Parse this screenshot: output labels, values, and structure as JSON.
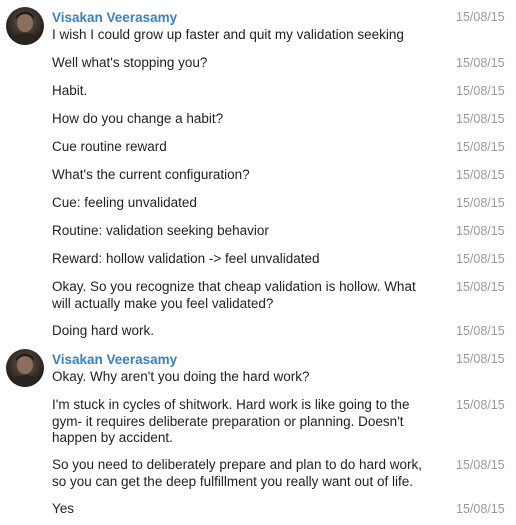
{
  "messages": [
    {
      "sender": "Visakan Veerasamy",
      "text": "I wish I could grow up faster and quit my validation seeking",
      "time": "15/08/15"
    },
    {
      "text": "Well what's stopping you?",
      "time": "15/08/15"
    },
    {
      "text": "Habit.",
      "time": "15/08/15"
    },
    {
      "text": "How do you change a habit?",
      "time": "15/08/15"
    },
    {
      "text": "Cue routine reward",
      "time": "15/08/15"
    },
    {
      "text": "What's the current configuration?",
      "time": "15/08/15"
    },
    {
      "text": "Cue: feeling unvalidated",
      "time": "15/08/15"
    },
    {
      "text": "Routine: validation seeking behavior",
      "time": "15/08/15"
    },
    {
      "text": "Reward: hollow validation -> feel unvalidated",
      "time": "15/08/15"
    },
    {
      "text": "Okay. So you recognize that cheap validation is hollow. What will actually make you feel validated?",
      "time": "15/08/15"
    },
    {
      "text": "Doing hard work.",
      "time": "15/08/15"
    },
    {
      "sender": "Visakan Veerasamy",
      "text": "Okay. Why aren't you doing the hard work?",
      "time": "15/08/15"
    },
    {
      "text": "I'm stuck in cycles of shitwork. Hard work is like going to the gym- it requires deliberate preparation or planning. Doesn't happen by accident.",
      "time": "15/08/15"
    },
    {
      "text": "So you need to deliberately prepare and plan to do hard work, so you can get the deep fulfillment you really want out of life.",
      "time": "15/08/15"
    },
    {
      "text": "Yes",
      "time": "15/08/15"
    }
  ]
}
